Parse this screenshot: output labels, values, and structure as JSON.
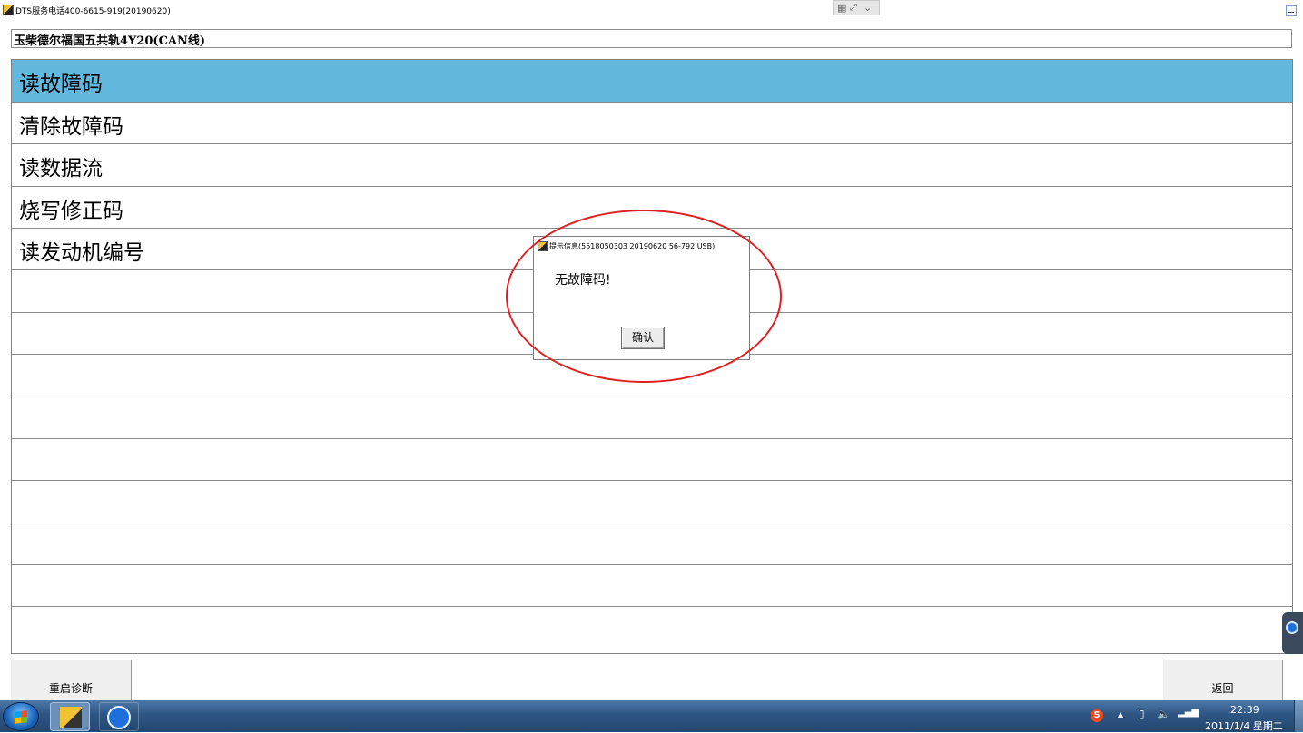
{
  "window": {
    "title": "DTS服务电话400-6615-919(20190620)"
  },
  "remote_toolbar": {
    "icons": [
      "grid-icon",
      "fullscreen-icon",
      "chevron-down-icon"
    ]
  },
  "engine": {
    "label": "玉柴德尔福国五共轨4Y20(CAN线)"
  },
  "menu": {
    "items": [
      {
        "label": "读故障码",
        "selected": true
      },
      {
        "label": "清除故障码",
        "selected": false
      },
      {
        "label": "读数据流",
        "selected": false
      },
      {
        "label": "烧写修正码",
        "selected": false
      },
      {
        "label": "读发动机编号",
        "selected": false
      },
      {
        "label": ""
      },
      {
        "label": ""
      },
      {
        "label": ""
      },
      {
        "label": ""
      },
      {
        "label": ""
      },
      {
        "label": ""
      },
      {
        "label": ""
      },
      {
        "label": ""
      },
      {
        "label": ""
      }
    ]
  },
  "buttons": {
    "restart": "重启诊断",
    "back": "返回"
  },
  "dialog": {
    "title": "提示信息(5518050303 20190620 56-792 USB)",
    "message": "无故障码!",
    "ok": "确认"
  },
  "taskbar": {
    "time": "22:39",
    "date": "2011/1/4 星期二",
    "sogou": "S"
  },
  "colors": {
    "selected_row": "#63b8de",
    "annotation": "#e02020",
    "taskbar": "#2e5583"
  }
}
